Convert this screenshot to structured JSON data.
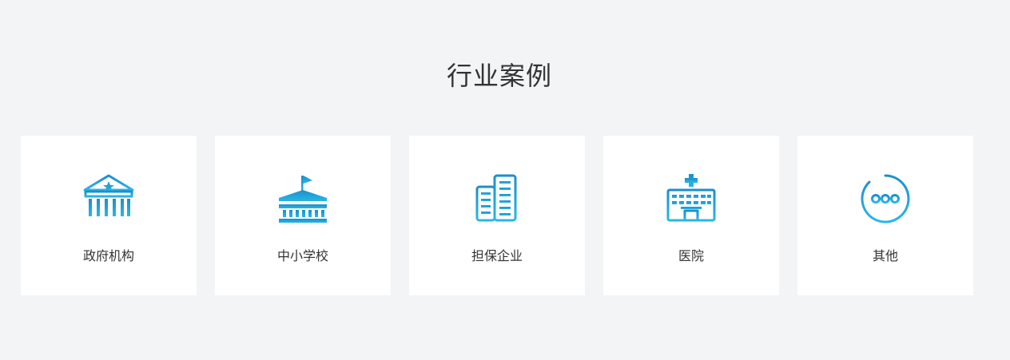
{
  "section": {
    "title": "行业案例"
  },
  "theme": {
    "background": "#f2f4f5",
    "card_background": "#ffffff",
    "icon_gradient_start": "#2bb4e4",
    "icon_gradient_end": "#1a87c6"
  },
  "cards": [
    {
      "label": "政府机构",
      "icon": "government-building-icon"
    },
    {
      "label": "中小学校",
      "icon": "school-building-icon"
    },
    {
      "label": "担保企业",
      "icon": "office-buildings-icon"
    },
    {
      "label": "医院",
      "icon": "hospital-icon"
    },
    {
      "label": "其他",
      "icon": "more-dots-icon"
    }
  ]
}
